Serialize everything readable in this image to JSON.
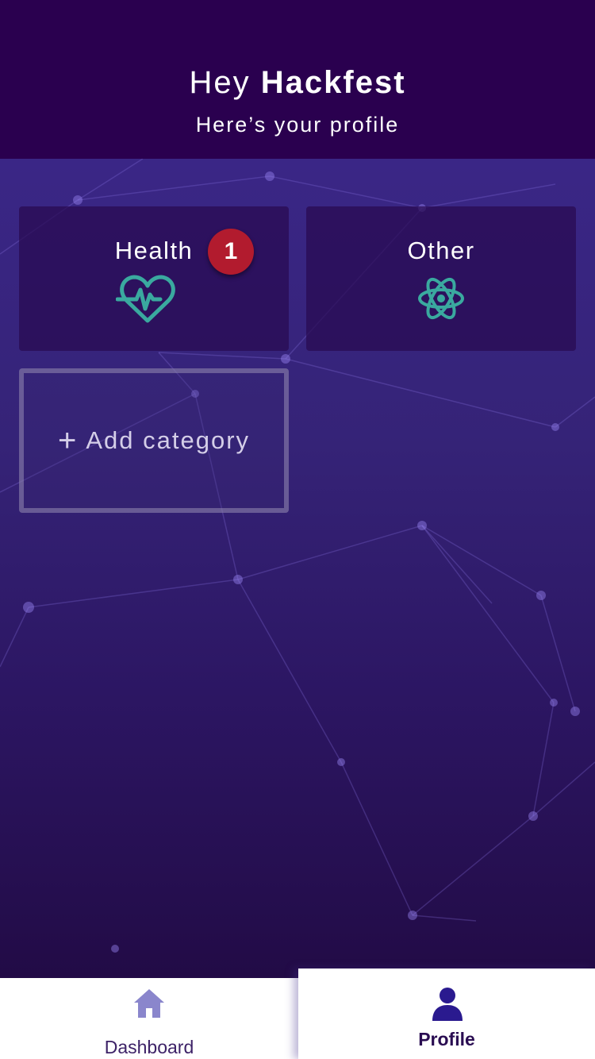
{
  "header": {
    "greeting_prefix": "Hey",
    "user_name": "Hackfest",
    "subtitle": "Here’s your profile"
  },
  "categories": [
    {
      "label": "Health",
      "icon": "heartbeat-icon",
      "badge": "1"
    },
    {
      "label": "Other",
      "icon": "atom-icon"
    }
  ],
  "add_category": {
    "icon": "plus-icon",
    "label": "Add category"
  },
  "tabbar": {
    "tabs": [
      {
        "label": "Dashboard",
        "icon": "home-icon",
        "active": false
      },
      {
        "label": "Profile",
        "icon": "user-icon",
        "active": true
      }
    ]
  },
  "colors": {
    "header_bg": "#2a004f",
    "icon_teal": "#3aa99f",
    "badge_red": "#b21b2e",
    "tab_active": "#2a1a8f",
    "tab_inactive_icon": "#8a86cc"
  }
}
